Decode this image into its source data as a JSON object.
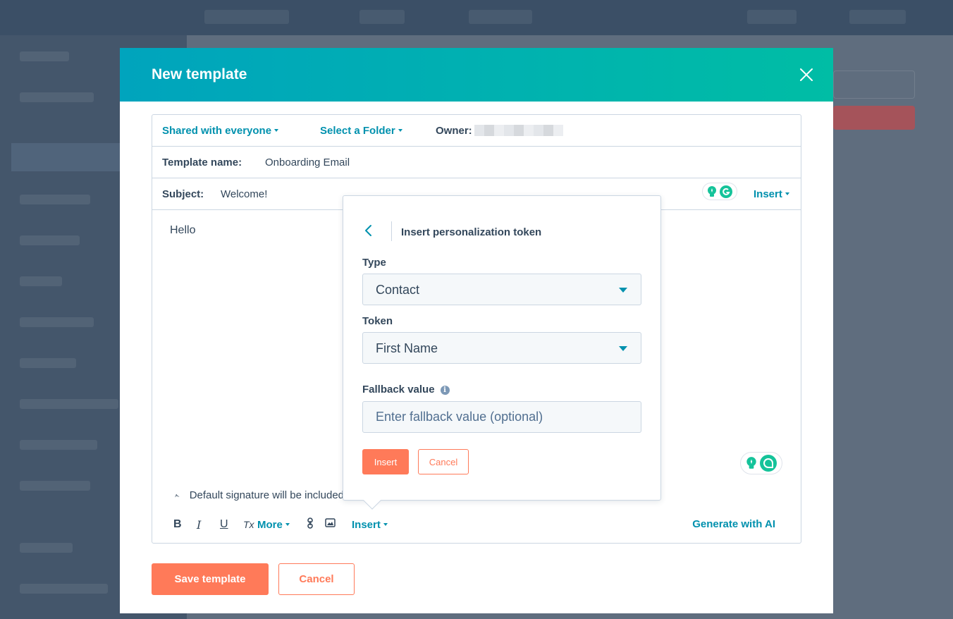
{
  "modal": {
    "title": "New template",
    "sharing": "Shared with everyone",
    "folder": "Select a Folder",
    "owner_label": "Owner:",
    "template_name_label": "Template name:",
    "template_name_value": "Onboarding Email",
    "subject_label": "Subject:",
    "subject_value": "Welcome!",
    "subject_insert": "Insert",
    "body_text": "Hello",
    "signature_text": "Default signature will be included",
    "toolbar": {
      "bold": "B",
      "italic": "I",
      "underline": "U",
      "clear_format": "Tx",
      "more": "More",
      "insert": "Insert",
      "generate_ai": "Generate with AI"
    },
    "save_button": "Save template",
    "cancel_button": "Cancel"
  },
  "popover": {
    "title": "Insert personalization token",
    "type_label": "Type",
    "type_value": "Contact",
    "token_label": "Token",
    "token_value": "First Name",
    "fallback_label": "Fallback value",
    "fallback_placeholder": "Enter fallback value (optional)",
    "info_glyph": "i",
    "insert_button": "Insert",
    "cancel_button": "Cancel"
  },
  "colors": {
    "accent": "#0091ae",
    "primary_button": "#ff7a59",
    "header_gradient_start": "#00a4bd",
    "header_gradient_end": "#00bda5",
    "text": "#33475b",
    "grammarly": "#15c39a"
  },
  "icons": [
    "close-icon",
    "back-chevron-icon",
    "lightbulb-icon",
    "grammarly-icon",
    "signature-icon",
    "link-icon",
    "image-icon"
  ]
}
